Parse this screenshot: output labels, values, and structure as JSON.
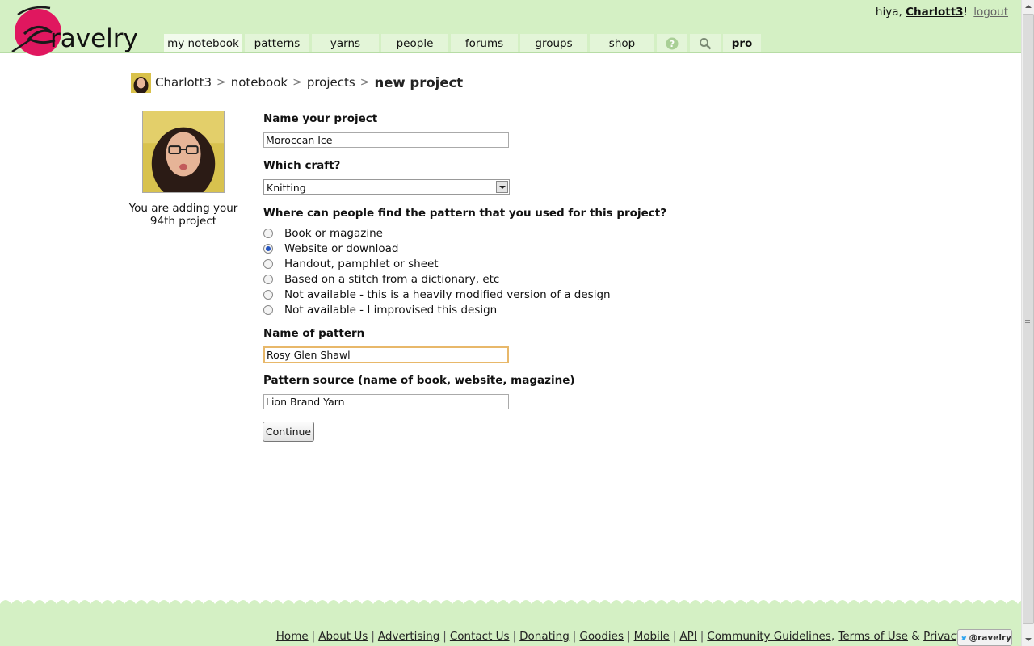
{
  "app": {
    "logo_text": "ravelry",
    "brand_color": "#e0175f"
  },
  "header": {
    "greeting_prefix": "hiya, ",
    "username": "Charlott3",
    "greeting_suffix": "!",
    "logout": "logout"
  },
  "nav": {
    "tabs": [
      {
        "label": "my notebook"
      },
      {
        "label": "patterns"
      },
      {
        "label": "yarns"
      },
      {
        "label": "people"
      },
      {
        "label": "forums"
      },
      {
        "label": "groups"
      },
      {
        "label": "shop"
      },
      {
        "icon": "help-icon"
      },
      {
        "icon": "search-icon"
      },
      {
        "label": "pro"
      }
    ]
  },
  "breadcrumb": {
    "user": "Charlott3",
    "sep": ">",
    "notebook": "notebook",
    "projects": "projects",
    "current": "new project"
  },
  "sidebar": {
    "adding_text": "You are adding your 94th project"
  },
  "form": {
    "name_label": "Name your project",
    "name_value": "Moroccan Ice",
    "craft_label": "Which craft?",
    "craft_value": "Knitting",
    "source_question": "Where can people find the pattern that you used for this project?",
    "source_options": [
      {
        "label": "Book or magazine",
        "checked": false
      },
      {
        "label": "Website or download",
        "checked": true
      },
      {
        "label": "Handout, pamphlet or sheet",
        "checked": false
      },
      {
        "label": "Based on a stitch from a dictionary, etc",
        "checked": false
      },
      {
        "label": "Not available - this is a heavily modified version of a design",
        "checked": false
      },
      {
        "label": "Not available - I improvised this design",
        "checked": false
      }
    ],
    "pattern_name_label": "Name of pattern",
    "pattern_name_value": "Rosy Glen Shawl",
    "pattern_source_label": "Pattern source (name of book, website, magazine)",
    "pattern_source_value": "Lion Brand Yarn",
    "continue_label": "Continue"
  },
  "footer": {
    "links": [
      "Home",
      "About Us",
      "Advertising",
      "Contact Us",
      "Donating",
      "Goodies",
      "Mobile",
      "API",
      "Community Guidelines",
      "Terms of Use",
      "Privacy"
    ],
    "separator": "|",
    "amp": "&",
    "twitter_label": "@ravelry"
  }
}
